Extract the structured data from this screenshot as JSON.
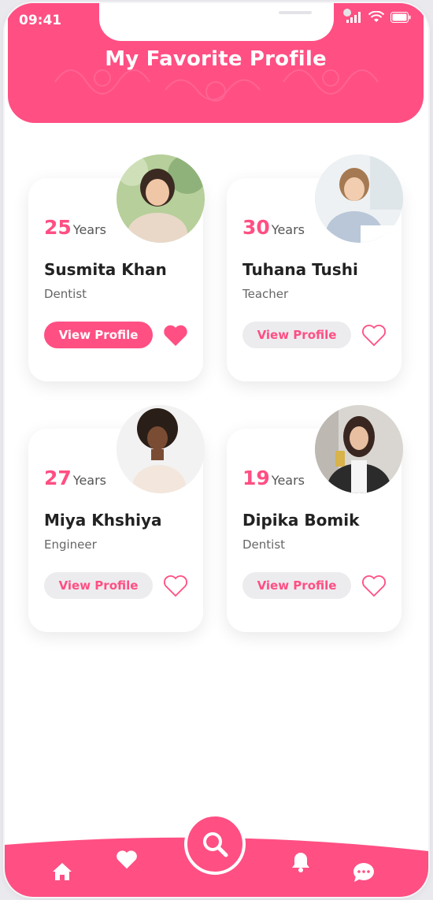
{
  "status_bar": {
    "time": "09:41"
  },
  "header": {
    "title": "My Favorite Profile"
  },
  "profiles": [
    {
      "age": "25",
      "age_unit": "Years",
      "name": "Susmita Khan",
      "profession": "Dentist",
      "button_label": "View Profile",
      "favorited": true
    },
    {
      "age": "30",
      "age_unit": "Years",
      "name": "Tuhana Tushi",
      "profession": "Teacher",
      "button_label": "View Profile",
      "favorited": false
    },
    {
      "age": "27",
      "age_unit": "Years",
      "name": "Miya Khshiya",
      "profession": "Engineer",
      "button_label": "View Profile",
      "favorited": false
    },
    {
      "age": "19",
      "age_unit": "Years",
      "name": "Dipika Bomik",
      "profession": "Dentist",
      "button_label": "View Profile",
      "favorited": false
    }
  ],
  "bottom_nav": {
    "items": [
      "home-icon",
      "heart-icon",
      "search-icon",
      "bell-icon",
      "chat-icon"
    ],
    "active": "search-icon"
  },
  "colors": {
    "accent": "#ff4f83",
    "inactive_button": "#ececef",
    "background": "#ffffff"
  }
}
